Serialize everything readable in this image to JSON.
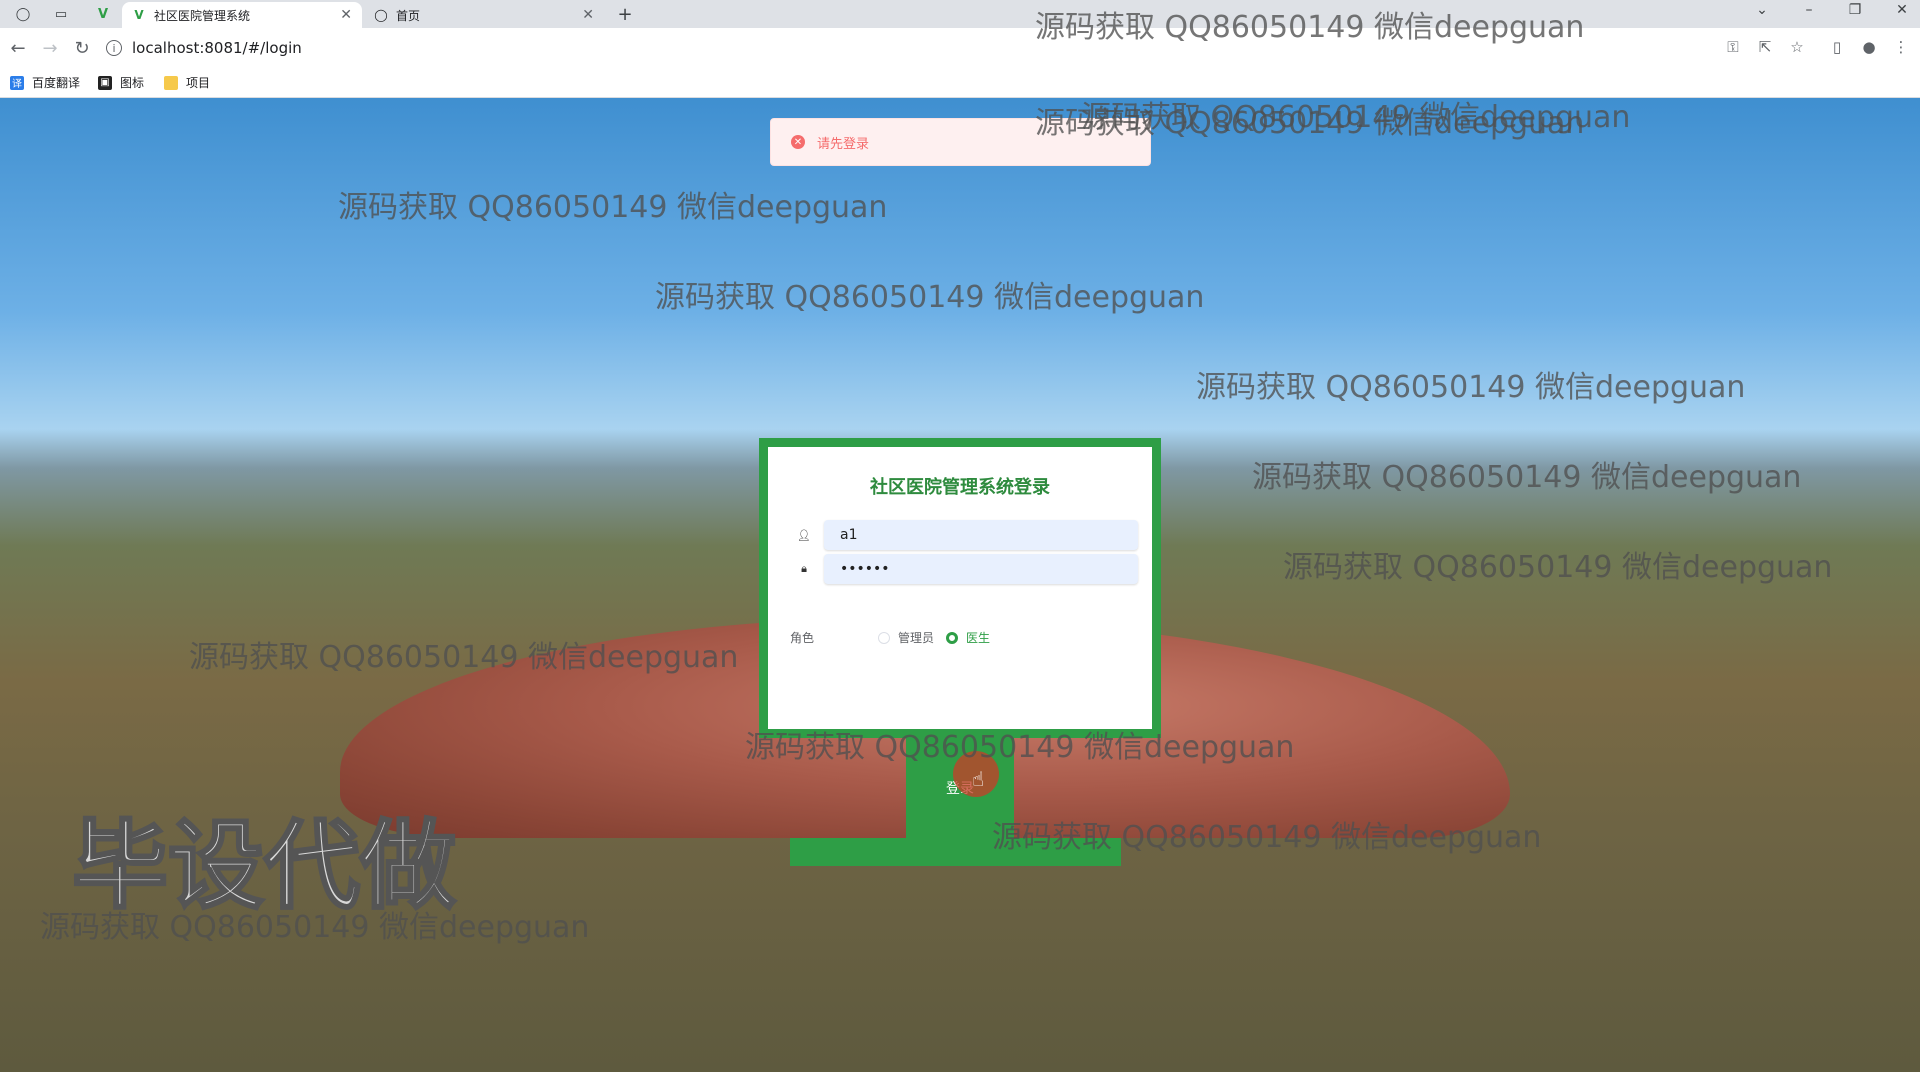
{
  "browser": {
    "tabs": [
      {
        "title": "社区医院管理系统",
        "active": true
      },
      {
        "title": "首页",
        "active": false
      }
    ],
    "new_tab": "+",
    "url": "localhost:8081/#/login",
    "bookmarks": [
      "百度翻译",
      "图标",
      "项目"
    ],
    "bookmark_badge": "译"
  },
  "watermark_text": "源码获取 QQ86050149 微信deepguan",
  "big_watermark": "毕设代做",
  "toast": {
    "message": "请先登录",
    "color": "#f56c6c"
  },
  "login": {
    "title": "社区医院管理系统登录",
    "username_value": "a1",
    "password_value": "••••••",
    "role_label": "角色",
    "roles": [
      {
        "label": "管理员",
        "checked": false
      },
      {
        "label": "医生",
        "checked": true
      }
    ],
    "submit_label": "登录",
    "accent_color": "#2e9e46"
  }
}
